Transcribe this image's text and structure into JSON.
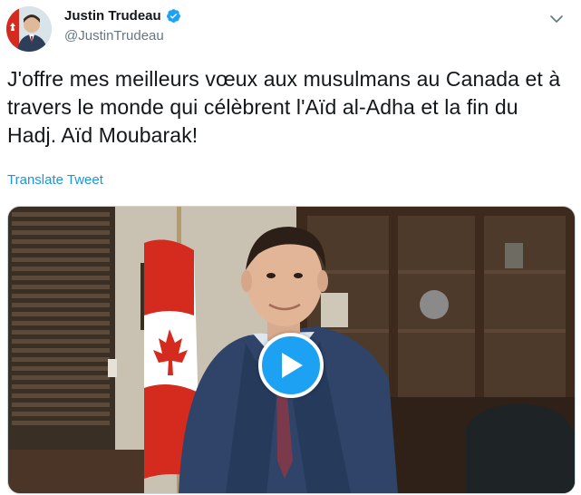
{
  "author": {
    "display_name": "Justin Trudeau",
    "handle": "@JustinTrudeau",
    "verified": true
  },
  "tweet": {
    "text": "J'offre mes meilleurs vœux aux musulmans au Canada et à travers le monde qui célèbrent l'Aïd al-Adha et la fin du Hadj. Aïd Moubarak!",
    "translate_label": "Translate Tweet"
  },
  "media": {
    "type": "video",
    "play_icon": "play-icon"
  },
  "icons": {
    "verified": "verified-badge-icon",
    "more": "chevron-down-icon"
  },
  "colors": {
    "accent": "#1da1f2",
    "link": "#1b95e0",
    "secondary_text": "#657786",
    "primary_text": "#14171a"
  }
}
